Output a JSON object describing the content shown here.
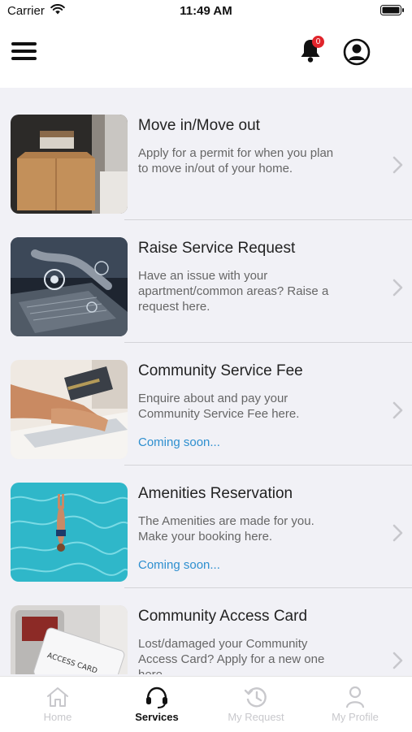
{
  "status_bar": {
    "carrier": "Carrier",
    "time": "11:49 AM"
  },
  "header": {
    "notification_count": "0"
  },
  "services": [
    {
      "title": "Move in/Move out",
      "description": "Apply for a permit for when you plan to move in/out of your home.",
      "note": "",
      "thumbnail": "moving-box-photo"
    },
    {
      "title": "Raise Service Request",
      "description": "Have an issue with your apartment/common areas? Raise a request here.",
      "note": "",
      "thumbnail": "laptop-service-photo"
    },
    {
      "title": "Community Service Fee",
      "description": "Enquire about and pay your Community Service Fee here.",
      "note": "Coming soon...",
      "thumbnail": "card-payment-photo"
    },
    {
      "title": "Amenities Reservation",
      "description": "The Amenities are made for you. Make your booking here.",
      "note": "Coming soon...",
      "thumbnail": "swimming-pool-photo"
    },
    {
      "title": "Community Access Card",
      "description": "Lost/damaged your Community Access Card? Apply for a new one here.",
      "note": "",
      "thumbnail": "access-card-photo",
      "thumbnail_text": "ACCESS CARD"
    }
  ],
  "tabs": [
    {
      "label": "Home",
      "icon": "home-icon",
      "active": false
    },
    {
      "label": "Services",
      "icon": "headset-icon",
      "active": true
    },
    {
      "label": "My Request",
      "icon": "history-icon",
      "active": false
    },
    {
      "label": "My Profile",
      "icon": "person-icon",
      "active": false
    }
  ],
  "colors": {
    "accent_blue": "#2e8fcf",
    "badge_red": "#e0242b",
    "background": "#f1f1f6",
    "inactive_tab": "#c8c8cc"
  }
}
